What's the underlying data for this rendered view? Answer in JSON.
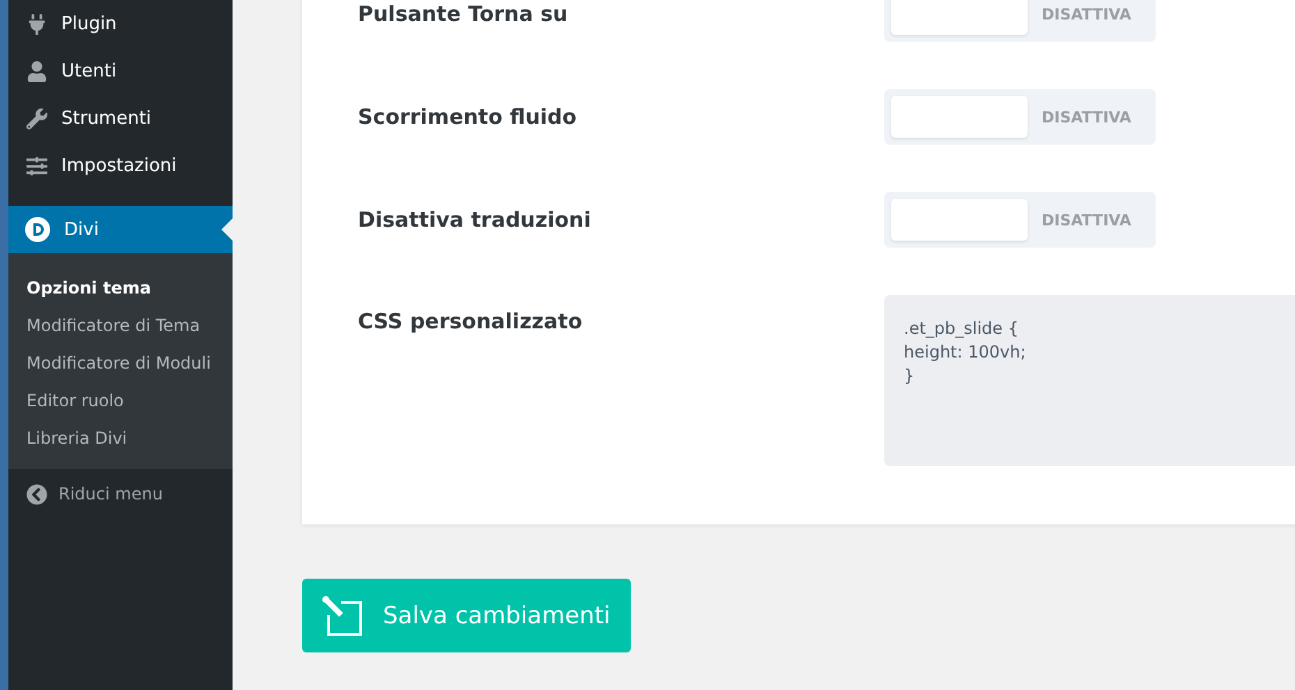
{
  "sidebar": {
    "items": [
      {
        "label": "Plugin",
        "selected": false
      },
      {
        "label": "Utenti",
        "selected": false
      },
      {
        "label": "Strumenti",
        "selected": false
      },
      {
        "label": "Impostazioni",
        "selected": false
      },
      {
        "label": "Divi",
        "selected": true
      }
    ],
    "submenu": [
      {
        "label": "Opzioni tema",
        "selected": true
      },
      {
        "label": "Modificatore di Tema",
        "selected": false
      },
      {
        "label": "Modificatore di Moduli",
        "selected": false
      },
      {
        "label": "Editor ruolo",
        "selected": false
      },
      {
        "label": "Libreria Divi",
        "selected": false
      }
    ],
    "collapse": "Riduci menu"
  },
  "settings": [
    {
      "kind": "toggle",
      "label": "Pulsante Torna su",
      "on": false,
      "state_text": "DISATTIVA"
    },
    {
      "kind": "toggle",
      "label": "Scorrimento fluido",
      "on": false,
      "state_text": "DISATTIVA"
    },
    {
      "kind": "toggle",
      "label": "Disattiva traduzioni",
      "on": false,
      "state_text": "DISATTIVA"
    },
    {
      "kind": "code",
      "label": "CSS personalizzato",
      "value": ".et_pb_slide {\nheight: 100vh;\n}"
    }
  ],
  "save_button": "Salva cambiamenti"
}
